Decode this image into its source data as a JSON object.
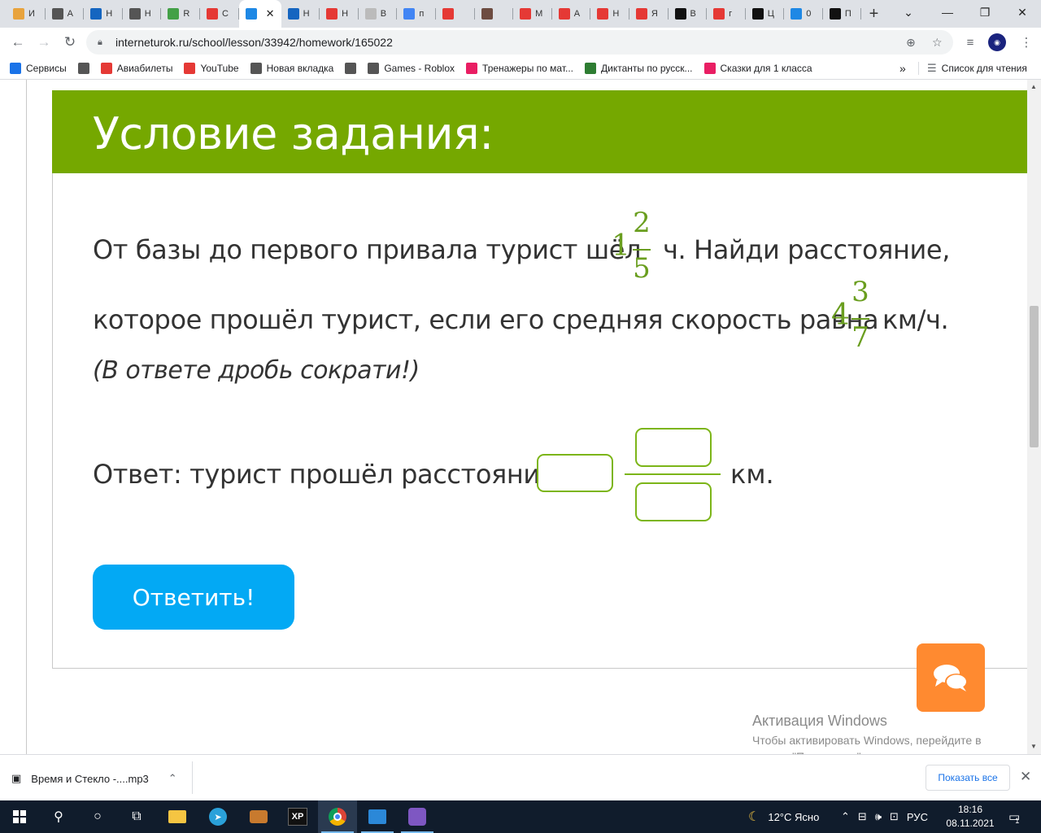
{
  "tabs": [
    {
      "initial": "И",
      "icon": "star-icon",
      "color": "#e8a33d"
    },
    {
      "initial": "А",
      "icon": "page-icon",
      "color": "#555"
    },
    {
      "initial": "Н",
      "icon": "gear-icon",
      "color": "#1565c0"
    },
    {
      "initial": "Н",
      "icon": "page-icon",
      "color": "#555"
    },
    {
      "initial": "R",
      "icon": "refresh-icon",
      "color": "#43a047"
    },
    {
      "initial": "С",
      "icon": "bolt-icon",
      "color": "#e53935"
    },
    {
      "initial": "",
      "icon": "play-icon",
      "color": "#1e88e5",
      "active": true
    },
    {
      "initial": "Н",
      "icon": "at-icon",
      "color": "#1565c0"
    },
    {
      "initial": "Н",
      "icon": "youtube-icon",
      "color": "#e53935"
    },
    {
      "initial": "В",
      "icon": "doc-icon",
      "color": "#bbb"
    },
    {
      "initial": "п",
      "icon": "google-icon",
      "color": "#4285f4"
    },
    {
      "initial": "",
      "icon": "youtube-icon",
      "color": "#e53935"
    },
    {
      "initial": "",
      "icon": "figure-icon",
      "color": "#6d4c41"
    },
    {
      "initial": "М",
      "icon": "youtube-icon",
      "color": "#e53935"
    },
    {
      "initial": "А",
      "icon": "youtube-icon",
      "color": "#e53935"
    },
    {
      "initial": "Н",
      "icon": "youtube-icon",
      "color": "#e53935"
    },
    {
      "initial": "Я",
      "icon": "youtube-icon",
      "color": "#e53935"
    },
    {
      "initial": "В",
      "icon": "v-icon",
      "color": "#111"
    },
    {
      "initial": "г",
      "icon": "youtube-icon",
      "color": "#e53935"
    },
    {
      "initial": "Ц",
      "icon": "z-icon",
      "color": "#111"
    },
    {
      "initial": "0",
      "icon": "clock-icon",
      "color": "#1e88e5"
    },
    {
      "initial": "П",
      "icon": "z-icon",
      "color": "#111"
    }
  ],
  "browser": {
    "url": "interneturok.ru/school/lesson/33942/homework/165022"
  },
  "bookmarks": [
    {
      "label": "Сервисы",
      "icon": "apps-icon",
      "color": "#1a73e8"
    },
    {
      "label": "",
      "icon": "page-icon",
      "color": "#555"
    },
    {
      "label": "Авиабилеты",
      "icon": "plane-icon",
      "color": "#e53935"
    },
    {
      "label": "YouTube",
      "icon": "youtube-icon",
      "color": "#e53935"
    },
    {
      "label": "Новая вкладка",
      "icon": "globe-icon",
      "color": "#555"
    },
    {
      "label": "",
      "icon": "globe-icon",
      "color": "#555"
    },
    {
      "label": "Games - Roblox",
      "icon": "roblox-icon",
      "color": "#555"
    },
    {
      "label": "Тренажеры по мат...",
      "icon": "hand-icon",
      "color": "#e91e63"
    },
    {
      "label": "Диктанты по русск...",
      "icon": "leaf-icon",
      "color": "#2e7d32"
    },
    {
      "label": "Сказки для 1 класса",
      "icon": "flamingo-icon",
      "color": "#e91e63"
    }
  ],
  "bookmarks_more": "»",
  "reading_list": "Список для чтения",
  "page": {
    "title": "Условие задания:",
    "line1_before": "От базы до первого привала турист шёл",
    "line1_after": "ч. Найди расстояние,",
    "frac1": {
      "whole": "1",
      "num": "2",
      "den": "5"
    },
    "line2_before": "которое прошёл турист, если его средняя скорость равна",
    "line2_after": "км/ч.",
    "frac2": {
      "whole": "4",
      "num": "3",
      "den": "7"
    },
    "hint": "(В ответе дробь сократи!)",
    "answer_label": "Ответ: турист прошёл расстояние",
    "answer_unit": "км.",
    "answer_whole": "",
    "answer_num": "",
    "answer_den": "",
    "submit_label": "Ответить!"
  },
  "activation": {
    "title": "Активация Windows",
    "text": "Чтобы активировать Windows, перейдите в раздел \"Параметры\"."
  },
  "downloads": {
    "file": "Время и Стекло -....mp3",
    "show_all": "Показать все"
  },
  "taskbar": {
    "weather": "12°C  Ясно",
    "lang": "РУС",
    "time": "18:16",
    "date": "08.11.2021",
    "notifications": "1"
  }
}
